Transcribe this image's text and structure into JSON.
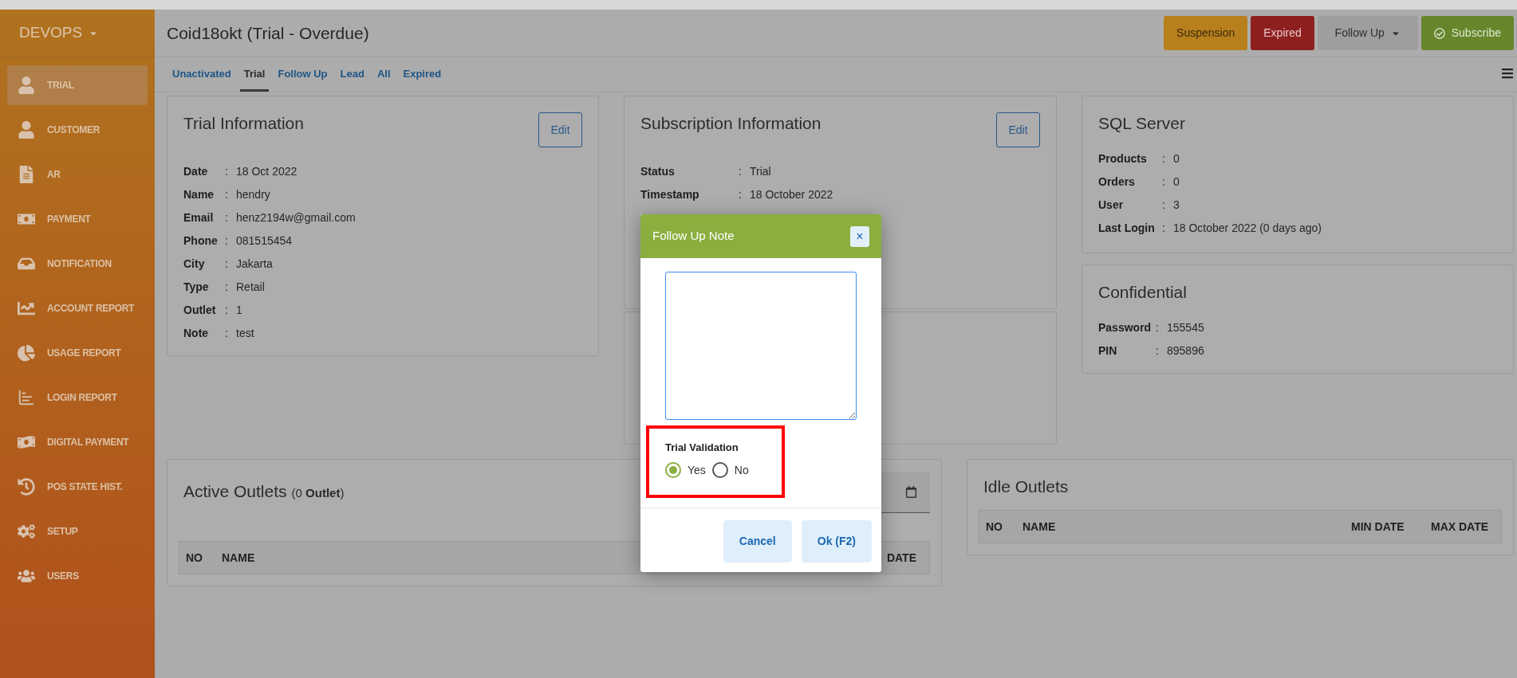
{
  "sidebar": {
    "brand": "DEVOPS",
    "items": [
      {
        "label": "TRIAL",
        "selected": true
      },
      {
        "label": "CUSTOMER",
        "selected": false
      },
      {
        "label": "AR",
        "selected": false
      },
      {
        "label": "PAYMENT",
        "selected": false
      },
      {
        "label": "NOTIFICATION",
        "selected": false
      },
      {
        "label": "ACCOUNT REPORT",
        "selected": false
      },
      {
        "label": "USAGE REPORT",
        "selected": false
      },
      {
        "label": "LOGIN REPORT",
        "selected": false
      },
      {
        "label": "DIGITAL PAYMENT",
        "selected": false
      },
      {
        "label": "POS STATE HIST.",
        "selected": false
      },
      {
        "label": "SETUP",
        "selected": false
      },
      {
        "label": "USERS",
        "selected": false
      }
    ]
  },
  "header": {
    "title": "Coid18okt (Trial - Overdue)",
    "buttons": [
      {
        "label": "Suspension",
        "kind": "warning"
      },
      {
        "label": "Expired",
        "kind": "danger"
      },
      {
        "label": "Follow Up",
        "kind": "dropdown"
      },
      {
        "label": "Subscribe",
        "kind": "success"
      }
    ]
  },
  "tabs": [
    {
      "label": "Unactivated",
      "selected": false
    },
    {
      "label": "Trial",
      "selected": true
    },
    {
      "label": "Follow Up",
      "selected": false
    },
    {
      "label": "Lead",
      "selected": false
    },
    {
      "label": "All",
      "selected": false
    },
    {
      "label": "Expired",
      "selected": false
    }
  ],
  "trial_information": {
    "title": "Trial Information",
    "edit": "Edit",
    "fields": [
      {
        "label": "Date",
        "value": "18 Oct 2022"
      },
      {
        "label": "Name",
        "value": "hendry"
      },
      {
        "label": "Email",
        "value": "henz2194w@gmail.com"
      },
      {
        "label": "Phone",
        "value": "081515454"
      },
      {
        "label": "City",
        "value": "Jakarta"
      },
      {
        "label": "Type",
        "value": "Retail"
      },
      {
        "label": "Outlet",
        "value": "1"
      },
      {
        "label": "Note",
        "value": "test"
      }
    ]
  },
  "subscription_information": {
    "title": "Subscription Information",
    "edit": "Edit",
    "fields": [
      {
        "label": "Status",
        "value": "Trial"
      },
      {
        "label": "Timestamp",
        "value": "18 October 2022"
      }
    ]
  },
  "separator": ":",
  "sql_server": {
    "title": "SQL Server",
    "fields": [
      {
        "label": "Products",
        "value": "0"
      },
      {
        "label": "Orders",
        "value": "0"
      },
      {
        "label": "User",
        "value": "3"
      },
      {
        "label": "Last Login",
        "value": "18 October 2022 (0 days ago)"
      }
    ]
  },
  "confidential": {
    "title": "Confidential",
    "fields": [
      {
        "label": "Password",
        "value": "155545"
      },
      {
        "label": "PIN",
        "value": "895896"
      }
    ]
  },
  "active_outlets": {
    "title": "Active Outlets",
    "count": "(0 **Outlet**)",
    "columns": [
      "NO",
      "NAME",
      "DATE"
    ]
  },
  "idle_outlets": {
    "title": "Idle Outlets",
    "columns": [
      "NO",
      "NAME",
      "MIN DATE",
      "MAX DATE"
    ]
  },
  "dialog": {
    "title": "Follow Up Note",
    "close": "×",
    "trial_validation": {
      "label": "Trial Validation",
      "options": [
        {
          "label": "Yes",
          "selected": true
        },
        {
          "label": "No",
          "selected": false
        }
      ]
    },
    "buttons": [
      "Cancel",
      "Ok (F2)"
    ]
  }
}
